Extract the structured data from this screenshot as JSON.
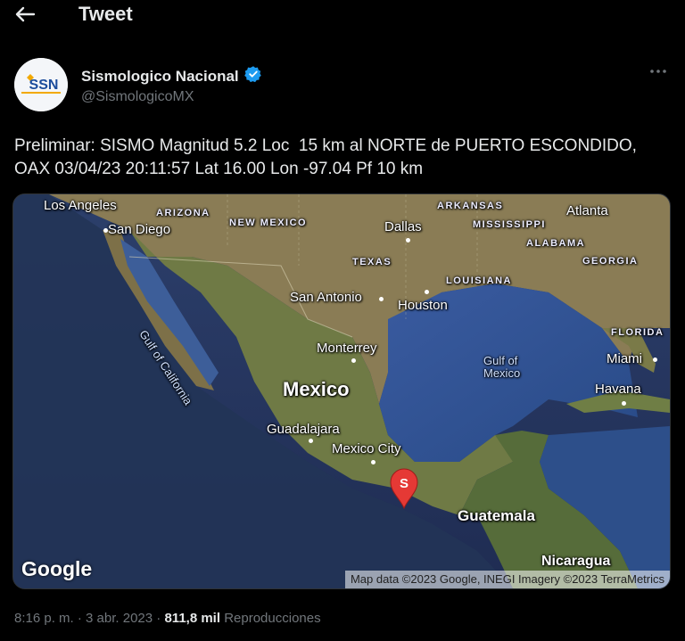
{
  "header": {
    "title": "Tweet"
  },
  "author": {
    "name": "Sismologico Nacional",
    "handle": "@SismologicoMX",
    "avatar_text": "SSN",
    "verified": true
  },
  "tweet": {
    "text": "Preliminar: SISMO Magnitud 5.2 Loc  15 km al NORTE de PUERTO ESCONDIDO, OAX 03/04/23 20:11:57 Lat 16.00 Lon -97.04 Pf 10 km"
  },
  "map": {
    "labels": {
      "los_angeles": "Los Angeles",
      "arizona": "ARIZONA",
      "new_mexico": "NEW MEXICO",
      "san_diego": "San Diego",
      "dallas": "Dallas",
      "arkansas": "ARKANSAS",
      "mississippi": "MISSISSIPPI",
      "atlanta": "Atlanta",
      "alabama": "ALABAMA",
      "georgia": "GEORGIA",
      "texas": "TEXAS",
      "louisiana": "LOUISIANA",
      "san_antonio": "San Antonio",
      "houston": "Houston",
      "florida": "FLORIDA",
      "gulf_california": "Gulf of California",
      "monterrey": "Monterrey",
      "gulf_mexico_1": "Gulf of",
      "gulf_mexico_2": "Mexico",
      "miami": "Miami",
      "mexico": "Mexico",
      "havana": "Havana",
      "guadalajara": "Guadalajara",
      "mexico_city": "Mexico City",
      "guatemala": "Guatemala",
      "nicaragua": "Nicaragua"
    },
    "marker_label": "S",
    "google_logo": "Google",
    "attribution": "Map data ©2023 Google, INEGI Imagery ©2023 TerraMetrics"
  },
  "footer": {
    "time": "8:16 p. m.",
    "separator": "·",
    "date": "3 abr. 2023",
    "views_count": "811,8 mil",
    "views_label": "Reproducciones"
  },
  "colors": {
    "background": "#000000",
    "text": "#e7e9ea",
    "muted": "#71767b",
    "verified": "#1d9bf0",
    "marker": "#e53935"
  }
}
